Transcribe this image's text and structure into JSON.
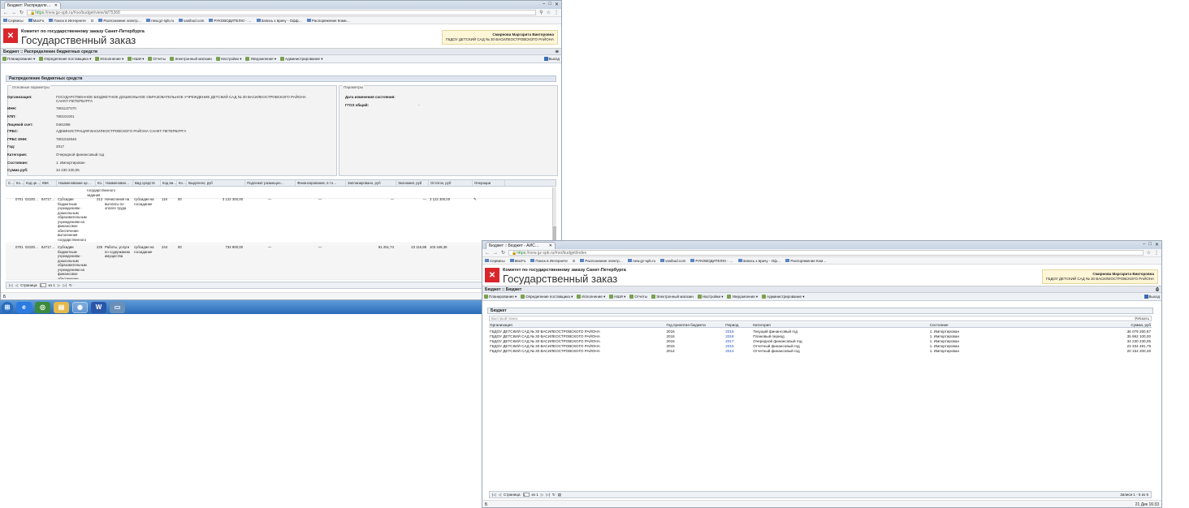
{
  "w1": {
    "tab_title": "Бюджет: Распределе…",
    "url_secure": "https",
    "url_rest": "://new.gz-spb.ru/#oo/budget/view/id/75368",
    "bookmarks": [
      "Сервисы",
      "MacFu",
      "Поиск в Интернете",
      "G",
      "Распознание электр…",
      "new.gz-spb.ru",
      "vasibud.com",
      "РУКОВОДИТЕЛЮ - …",
      "Запись к врачу - Офф…",
      "Распоряжение Коми…"
    ],
    "org_line": "Комитет по государственному заказу Санкт-Петербурга",
    "org_big": "Государственный заказ",
    "user_name": "Смирнова Маргарита Викторовна",
    "user_org": "ГБДОУ ДЕТСКИЙ САД № 30 ВАСИЛЕОСТРОВСКОГО РАЙОНА",
    "crumb": "Бюджет :: Распределение бюджетных средств",
    "menu": [
      "Планирование ▾",
      "Определение поставщика ▾",
      "Исполнение ▾",
      "НШИ ▾",
      "Отчеты",
      "Электронный магазин",
      "Настройки ▾",
      "Уведомления ▾",
      "Администрирование ▾"
    ],
    "exit": "Выход",
    "panel_title": "Распределение бюджетных средств",
    "legend_main": "Основные параметры",
    "legend_params": "Параметры",
    "fields": [
      {
        "k": "Организация:",
        "v": "ГОСУДАРСТВЕННОЕ БЮДЖЕТНОЕ ДОШКОЛЬНОЕ ОБРАЗОВАТЕЛЬНОЕ УЧРЕЖДЕНИЕ ДЕТСКИЙ САД № 30 ВАСИЛЕОСТРОВСКОГО РАЙОНА САНКТ-ПЕТЕРБУРГА"
      },
      {
        "k": "ИНН:",
        "v": "7801137370"
      },
      {
        "k": "КПП:",
        "v": "780101001"
      },
      {
        "k": "Лицевой счет:",
        "v": "0461088"
      },
      {
        "k": "ГРБС:",
        "v": "АДМИНИСТРАЦИЯ ВАСИЛЕОСТРОВСКОГО РАЙОНА САНКТ-ПЕТЕРБУРГА"
      },
      {
        "k": "ГРБС ИНН:",
        "v": "7801042946"
      },
      {
        "k": "Год:",
        "v": "2017"
      },
      {
        "k": "Категория:",
        "v": "Очередной финансовый год"
      },
      {
        "k": "Состояние:",
        "v": "1. Импортирован"
      },
      {
        "k": "Сумма руб:",
        "v": "34 230 230,05"
      }
    ],
    "right_fields": [
      {
        "k": "Дата изменения состояния:",
        "v": ""
      },
      {
        "k": "ГГОЗ общий:",
        "v": "-"
      }
    ],
    "grid_headers": [
      "С…",
      "Ко…",
      "Код це…",
      "КБК",
      "Наименование це…",
      "Ко…",
      "Наименован…",
      "Вид средств",
      "Код ви…",
      "Ко…",
      "Выделено, руб",
      "Подлежит размещен…",
      "Финансирование, в то…",
      "Запланировано, руб",
      "Экономия, руб",
      "Остаток, руб",
      "Операции"
    ],
    "grid_rows": [
      [
        "",
        "",
        "",
        "",
        "государственного задания",
        "",
        "",
        "",
        "",
        "",
        "",
        "",
        "",
        "",
        "",
        "",
        ""
      ],
      [
        "",
        "0701",
        "02100…",
        "84717…",
        "Субсидии бюджетным учреждениям - дошкольным образовательным учреждениям на финансовое обеспечение выполнения государственного задания",
        "213",
        "Начисления на выплаты по оплате труда",
        "субсидии на госзадание",
        "119",
        "00",
        "3 122 300,00",
        "—",
        "—",
        "—",
        "—",
        "3 122 300,00",
        "✎"
      ],
      [
        "",
        "0701",
        "02100…",
        "84717…",
        "Субсидии бюджетным учреждениям - дошкольным образовательным учреждениям на финансовое обеспечение выполнения",
        "225",
        "Работы, услуги по содержанию имущества",
        "субсидии на госзадание",
        "244",
        "00",
        "734 900,00",
        "—",
        "—",
        "91 251,74",
        "23 115,98",
        "103 448,35",
        ""
      ]
    ],
    "pager_page": "Страница",
    "pager_num": "1",
    "pager_of": "из 1",
    "status_text": "Б"
  },
  "w2": {
    "tab_title": "Бюджет :: Бюджет - АИС…",
    "url_secure": "https",
    "url_rest": "://new.gz-spb.ru/#oo/budget/index",
    "bookmarks": [
      "Сервисы",
      "MacFu",
      "Поиск в Интернете",
      "G",
      "Распознание электр…",
      "new.gz-spb.ru",
      "vasibud.com",
      "РУКОВОДИТЕЛЮ - …",
      "Запись к врачу - Оф…",
      "Распоряжение Ком…"
    ],
    "org_line": "Комитет по государственному заказу Санкт-Петербурга",
    "org_big": "Государственный заказ",
    "user_name": "Смирнова Маргарита Викторовна",
    "user_org": "ГБДОУ ДЕТСКИЙ САД № 30 ВАСИЛЕОСТРОВСКОГО РАЙОНА",
    "crumb": "Бюджет :: Бюджет",
    "menu": [
      "Планирование ▾",
      "Определение поставщика ▾",
      "Исполнение ▾",
      "НШИ ▾",
      "Отчеты",
      "Электронный магазин",
      "Настройки ▾",
      "Уведомления ▾",
      "Администрирование ▾"
    ],
    "exit": "Выход",
    "panel_title": "Бюджет",
    "search_placeholder": "Быстрый поиск",
    "search_button": "Искать",
    "headers": [
      "Организация",
      "Год принятия бюджета",
      "Период",
      "Категория",
      "Состояние",
      "Сумма, руб"
    ],
    "rows": [
      [
        "ГБДОУ ДЕТСКИЙ САД № 30 ВАСИЛЕОСТРОВСКОГО РАЙОНА",
        "2016",
        "2016",
        "Текущий финансовый год",
        "1. Импортирован",
        "36 079 260,67"
      ],
      [
        "ГБДОУ ДЕТСКИЙ САД № 30 ВАСИЛЕОСТРОВСКОГО РАЙОНА",
        "2016",
        "2018",
        "Плановый период",
        "1. Импортирован",
        "35 962 100,00"
      ],
      [
        "ГБДОУ ДЕТСКИЙ САД № 30 ВАСИЛЕОСТРОВСКОГО РАЙОНА",
        "2016",
        "2017",
        "Очередной финансовый год",
        "1. Импортирован",
        "34 230 230,05"
      ],
      [
        "ГБДОУ ДЕТСКИЙ САД № 30 ВАСИЛЕОСТРОВСКОГО РАЙОНА",
        "2015",
        "2015",
        "Отчетный финансовый год",
        "1. Импортирован",
        "23 334 491,79"
      ],
      [
        "ГБДОУ ДЕТСКИЙ САД № 30 ВАСИЛЕОСТРОВСКОГО РАЙОНА",
        "2014",
        "2014",
        "Отчетный финансовый год",
        "1. Импортирован",
        "20 154 200,46"
      ]
    ],
    "pager_page": "Страница",
    "pager_num": "1",
    "pager_of": "из 1",
    "records": "Записи 1 - 5 из 5",
    "status_text": "Б",
    "clock": "21 Дек 16:33"
  }
}
